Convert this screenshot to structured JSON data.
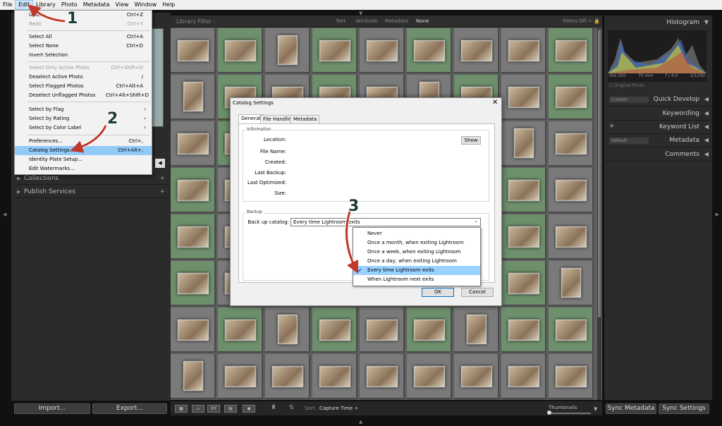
{
  "menubar": {
    "items": [
      "File",
      "Edit",
      "Library",
      "Photo",
      "Metadata",
      "View",
      "Window",
      "Help"
    ],
    "active": "Edit"
  },
  "edit_menu": {
    "items": [
      {
        "label": "Undo",
        "shortcut": "Ctrl+Z",
        "disabled": false
      },
      {
        "label": "Redo",
        "shortcut": "Ctrl+Y",
        "disabled": true
      },
      {
        "label": "Select All",
        "shortcut": "Ctrl+A"
      },
      {
        "label": "Select None",
        "shortcut": "Ctrl+D"
      },
      {
        "label": "Invert Selection",
        "shortcut": ""
      },
      {
        "label": "Select Only Active Photo",
        "shortcut": "Ctrl+Shift+D",
        "disabled": true
      },
      {
        "label": "Deselect Active Photo",
        "shortcut": "/"
      },
      {
        "label": "Select Flagged Photos",
        "shortcut": "Ctrl+Alt+A"
      },
      {
        "label": "Deselect Unflagged Photos",
        "shortcut": "Ctrl+Alt+Shift+D"
      },
      {
        "label": "Select by Flag",
        "shortcut": ""
      },
      {
        "label": "Select by Rating",
        "shortcut": ""
      },
      {
        "label": "Select by Color Label",
        "shortcut": ""
      },
      {
        "label": "Preferences...",
        "shortcut": "Ctrl+,"
      },
      {
        "label": "Catalog Settings...",
        "shortcut": "Ctrl+Alt+,"
      },
      {
        "label": "Identity Plate Setup...",
        "shortcut": ""
      },
      {
        "label": "Edit Watermarks...",
        "shortcut": ""
      }
    ]
  },
  "library_filter": {
    "label": "Library Filter :",
    "options": [
      "Text",
      "Attribute",
      "Metadata",
      "None"
    ],
    "selected": "None",
    "filters": "Filters Off ÷"
  },
  "left_panel": {
    "collections": "Collections",
    "publish": "Publish Services",
    "import": "Import...",
    "export": "Export..."
  },
  "right_panel": {
    "histogram": "Histogram",
    "iso": "ISO 250",
    "focal": "70 mm",
    "aperture": "f / 4.0",
    "shutter": "1/1250",
    "original_photo": "Original Photo",
    "quick_develop": "Quick Develop",
    "quick_develop_preset": "Custom",
    "keywording": "Keywording",
    "keyword_list": "Keyword List",
    "metadata": "Metadata",
    "metadata_preset": "Default",
    "comments": "Comments",
    "sync_metadata": "Sync Metadata",
    "sync_settings": "Sync Settings"
  },
  "toolbar": {
    "sort_label": "Sort:",
    "sort_value": "Capture Time ÷",
    "thumbnails": "Thumbnails"
  },
  "dialog": {
    "title": "Catalog Settings",
    "tabs": [
      "General",
      "File Handling",
      "Metadata"
    ],
    "info_group": "Information",
    "fields": [
      "Location:",
      "File Name:",
      "Created:",
      "Last Backup:",
      "Last Optimized:",
      "Size:"
    ],
    "show_button": "Show",
    "backup_group": "Backup",
    "backup_label": "Back up catalog:",
    "backup_value": "Every time Lightroom exits",
    "options": [
      "Never",
      "Once a month, when exiting Lightroom",
      "Once a week, when exiting Lightroom",
      "Once a day, when exiting Lightroom",
      "Every time Lightroom exits",
      "When Lightroom next exits"
    ],
    "selected_option": 4,
    "ok": "OK",
    "cancel": "Cancel"
  },
  "annotations": {
    "step1": "1",
    "step2": "2",
    "step3": "3"
  },
  "colors": {
    "panel": "#2b2b2b",
    "grid": "#5e5e5e",
    "highlight": "#91c9f7",
    "annotation_arrow": "#c0392b"
  }
}
